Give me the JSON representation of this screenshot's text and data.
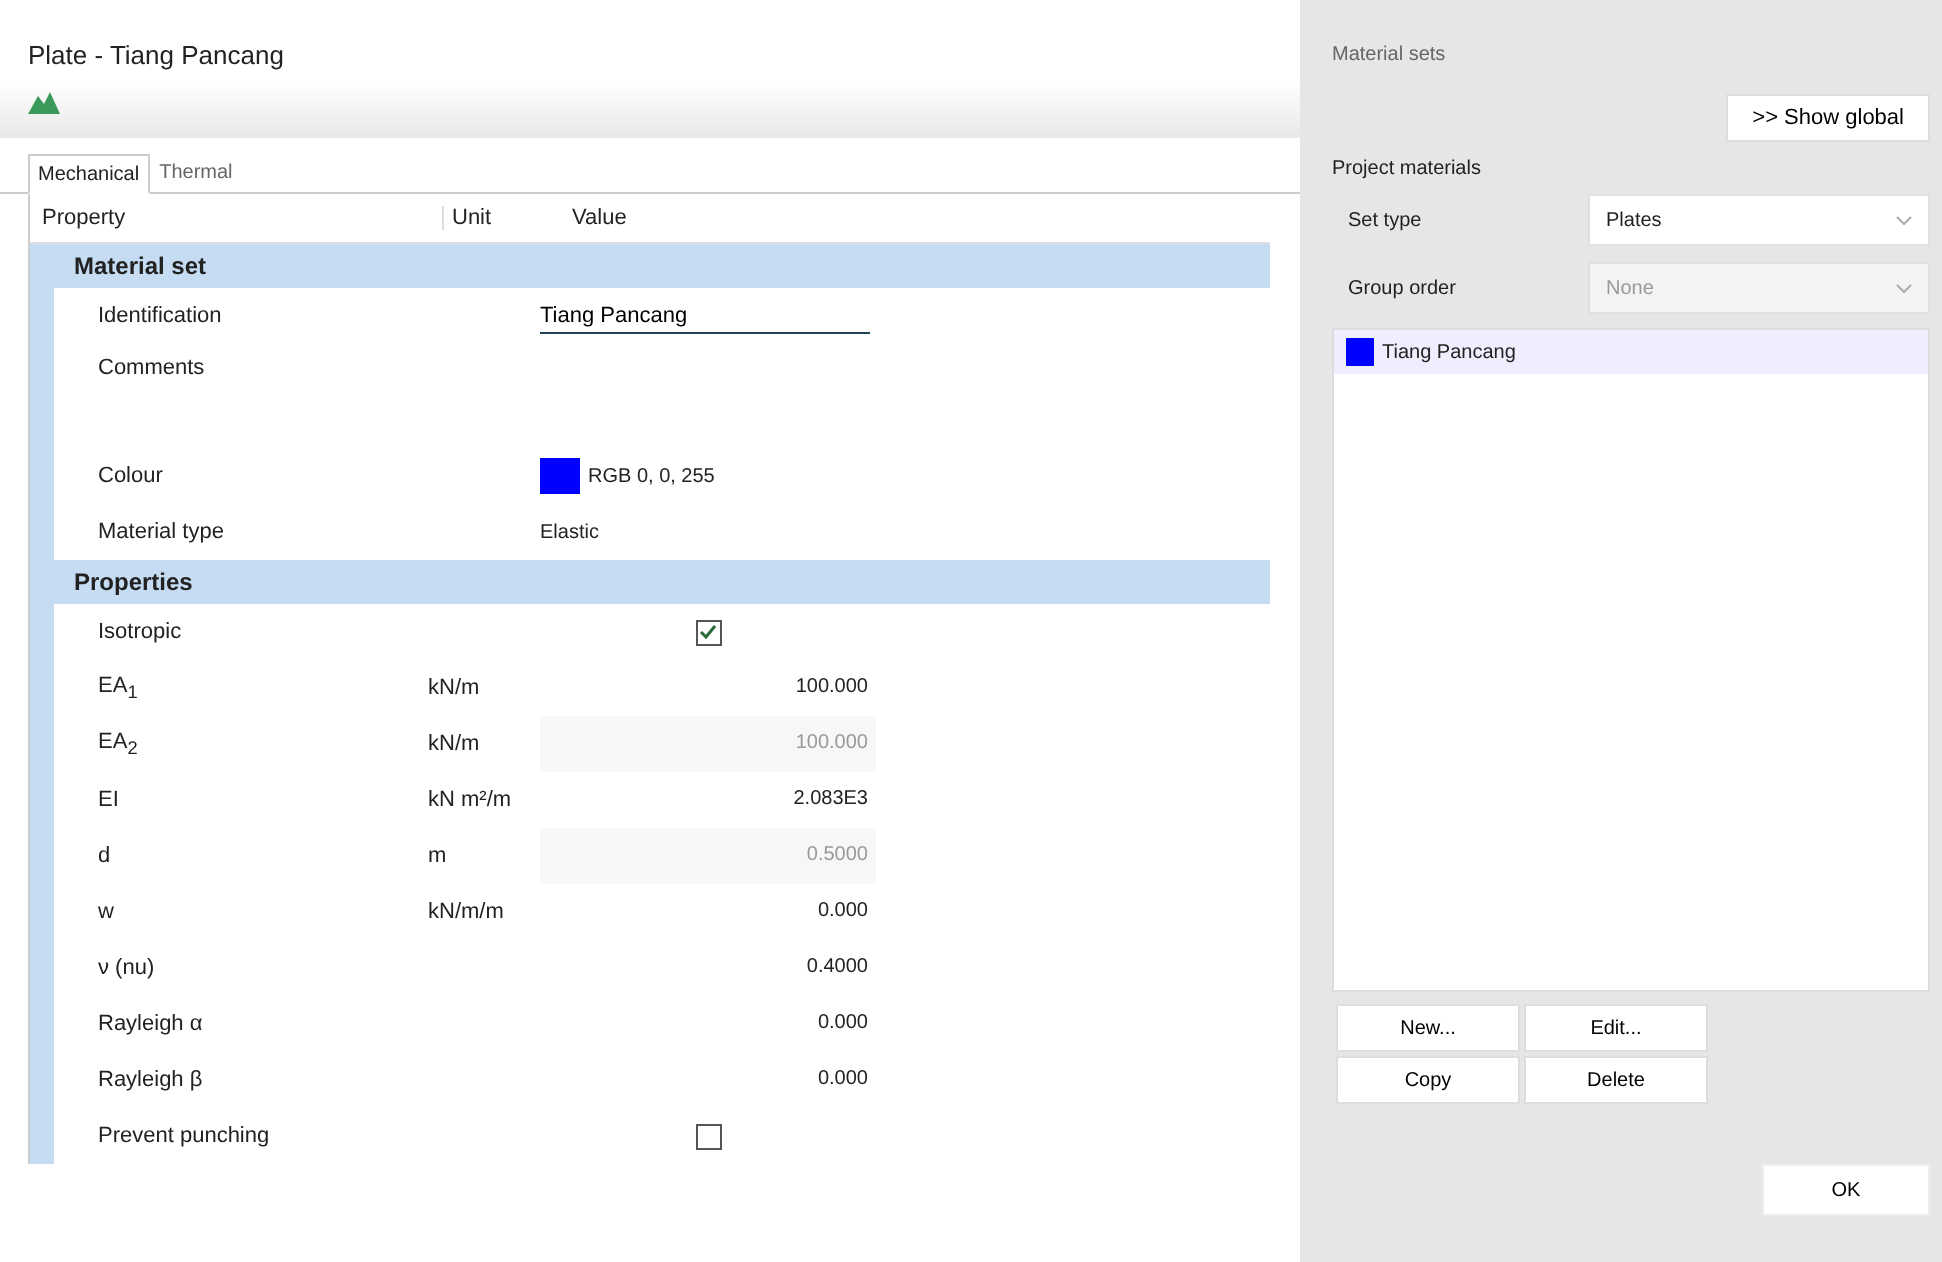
{
  "window": {
    "title": "Plate - Tiang Pancang"
  },
  "tabs": [
    {
      "label": "Mechanical",
      "selected": true
    },
    {
      "label": "Thermal",
      "selected": false
    }
  ],
  "table": {
    "columns": [
      "Property",
      "Unit",
      "Value"
    ],
    "groups": [
      {
        "title": "Material set",
        "rows": [
          {
            "kind": "field",
            "label": "Identification",
            "value": "Tiang Pancang"
          },
          {
            "kind": "comments",
            "label": "Comments"
          },
          {
            "kind": "color",
            "label": "Colour",
            "value": "RGB 0, 0, 255",
            "color": "#0000ff"
          },
          {
            "kind": "text",
            "label": "Material type",
            "value": "Elastic"
          }
        ]
      },
      {
        "title": "Properties",
        "rows": [
          {
            "kind": "checkbox",
            "label": "Isotropic",
            "checked": true
          },
          {
            "kind": "number",
            "label": "EA$_{1}$",
            "unit": "kN/m",
            "value": "100.000",
            "disabled": false
          },
          {
            "kind": "number",
            "label": "EA$_{2}$",
            "unit": "kN/m",
            "value": "100.000",
            "disabled": true
          },
          {
            "kind": "number",
            "label": "EI",
            "unit": "kN m²/m",
            "value": "2.083E3",
            "disabled": false
          },
          {
            "kind": "number",
            "label": "d",
            "unit": "m",
            "value": "0.5000",
            "disabled": true
          },
          {
            "kind": "number",
            "label": "w",
            "unit": "kN/m/m",
            "value": "0.000",
            "disabled": false
          },
          {
            "kind": "number",
            "label": "ν (nu)",
            "value": "0.4000",
            "disabled": false
          },
          {
            "kind": "number",
            "label": "Rayleigh α",
            "value": "0.000",
            "disabled": false
          },
          {
            "kind": "number",
            "label": "Rayleigh β",
            "value": "0.000",
            "disabled": false
          },
          {
            "kind": "checkbox",
            "label": "Prevent punching",
            "checked": false
          }
        ]
      }
    ]
  },
  "side": {
    "title": "Material sets",
    "show_global": ">> Show global",
    "section": "Project materials",
    "set_type": {
      "label": "Set type",
      "value": "Plates",
      "disabled": false
    },
    "group_order": {
      "label": "Group order",
      "value": "None",
      "disabled": true
    },
    "materials": [
      {
        "name": "Tiang Pancang",
        "color": "#0000ff",
        "selected": true
      }
    ],
    "buttons": [
      {
        "label": "New..."
      },
      {
        "label": "Edit..."
      },
      {
        "label": "Copy"
      },
      {
        "label": "Delete"
      }
    ],
    "ok": "OK"
  }
}
